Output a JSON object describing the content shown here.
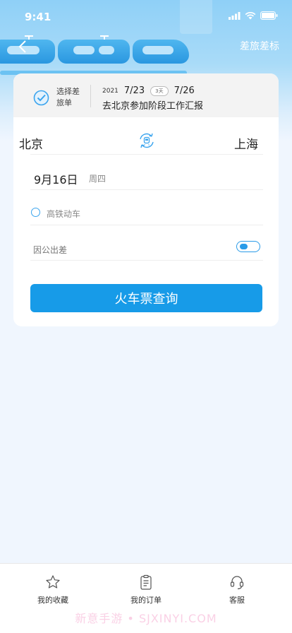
{
  "status_bar": {
    "time": "9:41"
  },
  "header": {
    "back_icon": "chevron-left-icon",
    "standard_link": "差旅差标"
  },
  "trip": {
    "select_label": "选择差旅单",
    "year": "2021",
    "start_date": "7/23",
    "days": "3天",
    "end_date": "7/26",
    "title": "去北京参加阶段工作汇报"
  },
  "search": {
    "from_city": "北京",
    "to_city": "上海",
    "date": "9月16日",
    "weekday": "周四",
    "high_speed_label": "高铁动车",
    "business_label": "因公出差",
    "business_on": true,
    "search_button": "火车票查询"
  },
  "tabbar": {
    "items": [
      {
        "label": "我的收藏",
        "icon": "star-icon"
      },
      {
        "label": "我的订单",
        "icon": "clipboard-icon"
      },
      {
        "label": "客服",
        "icon": "headset-icon"
      }
    ]
  },
  "watermark": "新意手游 • SJXINYI.COM",
  "colors": {
    "primary": "#179be8",
    "background": "#f0f6fe"
  }
}
